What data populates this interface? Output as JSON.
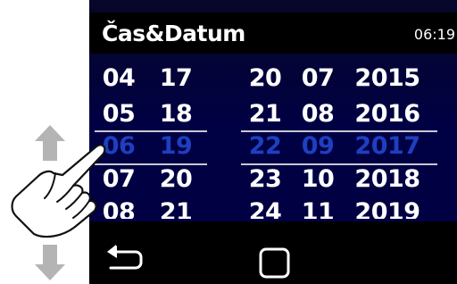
{
  "header": {
    "title": "Čas&Datum",
    "time": "06:19"
  },
  "picker": {
    "columns": [
      {
        "name": "day",
        "values": [
          "04",
          "05",
          "06",
          "07",
          "08"
        ],
        "selected_index": 2
      },
      {
        "name": "month",
        "values": [
          "17",
          "18",
          "19",
          "20",
          "21"
        ],
        "selected_index": 2
      },
      {
        "name": "hour",
        "values": [
          "20",
          "21",
          "22",
          "23",
          "24"
        ],
        "selected_index": 2
      },
      {
        "name": "minute",
        "values": [
          "07",
          "08",
          "09",
          "10",
          "11"
        ],
        "selected_index": 2
      },
      {
        "name": "year",
        "values": [
          "2015",
          "2016",
          "2017",
          "2018",
          "2019"
        ],
        "selected_index": 2
      }
    ],
    "selected_color": "#1e3fbf"
  },
  "footer": {
    "back_icon": "back-arrow-icon",
    "home_icon": "square-home-icon"
  },
  "side_controls": {
    "up_icon": "up-arrow-icon",
    "down_icon": "down-arrow-icon",
    "pointer_icon": "hand-pointer-icon",
    "icon_color": "#b4b4b4"
  }
}
